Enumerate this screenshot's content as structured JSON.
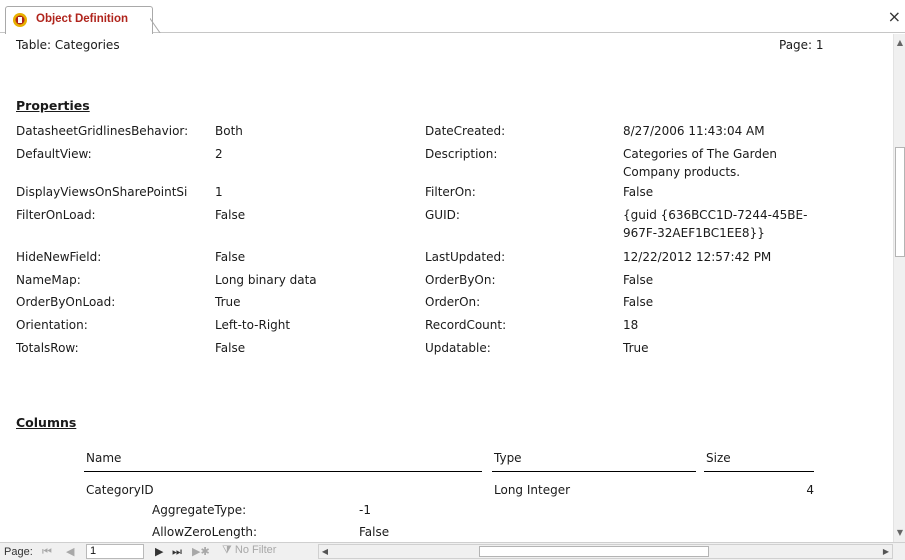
{
  "tab": {
    "title": "Object Definition",
    "icon": "access-report-icon",
    "close_label": "×"
  },
  "report": {
    "header_left": "Table: Categories",
    "header_right": "Page: 1",
    "properties_title": "Properties",
    "properties_left": [
      {
        "name": "DatasheetGridlinesBehavior:",
        "value": "Both"
      },
      {
        "name": "DefaultView:",
        "value": "2"
      },
      {
        "name": "DisplayViewsOnSharePointSi",
        "value": "1"
      },
      {
        "name": "FilterOnLoad:",
        "value": "False"
      },
      {
        "name": "HideNewField:",
        "value": "False"
      },
      {
        "name": "NameMap:",
        "value": "Long binary data"
      },
      {
        "name": "OrderByOnLoad:",
        "value": "True"
      },
      {
        "name": "Orientation:",
        "value": "Left-to-Right"
      },
      {
        "name": "TotalsRow:",
        "value": "False"
      }
    ],
    "properties_right": [
      {
        "name": "DateCreated:",
        "value": "8/27/2006 11:43:04 AM",
        "value2": ""
      },
      {
        "name": "Description:",
        "value": "Categories of The Garden",
        "value2": "Company products."
      },
      {
        "name": "FilterOn:",
        "value": "False",
        "value2": ""
      },
      {
        "name": "GUID:",
        "value": "{guid {636BCC1D-7244-45BE-",
        "value2": "967F-32AEF1BC1EE8}}"
      },
      {
        "name": "LastUpdated:",
        "value": "12/22/2012 12:57:42 PM",
        "value2": ""
      },
      {
        "name": "OrderByOn:",
        "value": "False",
        "value2": ""
      },
      {
        "name": "OrderOn:",
        "value": "False",
        "value2": ""
      },
      {
        "name": "RecordCount:",
        "value": "18",
        "value2": ""
      },
      {
        "name": "Updatable:",
        "value": "True",
        "value2": ""
      }
    ],
    "columns_title": "Columns",
    "column_headers": {
      "name": "Name",
      "type": "Type",
      "size": "Size"
    },
    "columns": [
      {
        "name": "CategoryID",
        "type": "Long Integer",
        "size": "4",
        "props": [
          {
            "name": "AggregateType:",
            "value": "-1"
          },
          {
            "name": "AllowZeroLength:",
            "value": "False"
          }
        ]
      }
    ]
  },
  "navbar": {
    "page_label": "Page:",
    "first": "⏮",
    "prev": "◀",
    "record": "1",
    "next": "▶",
    "last": "⏭",
    "new": "▶✱",
    "filter": "No Filter",
    "scroll_left": "◀",
    "scroll_right": "▶"
  }
}
